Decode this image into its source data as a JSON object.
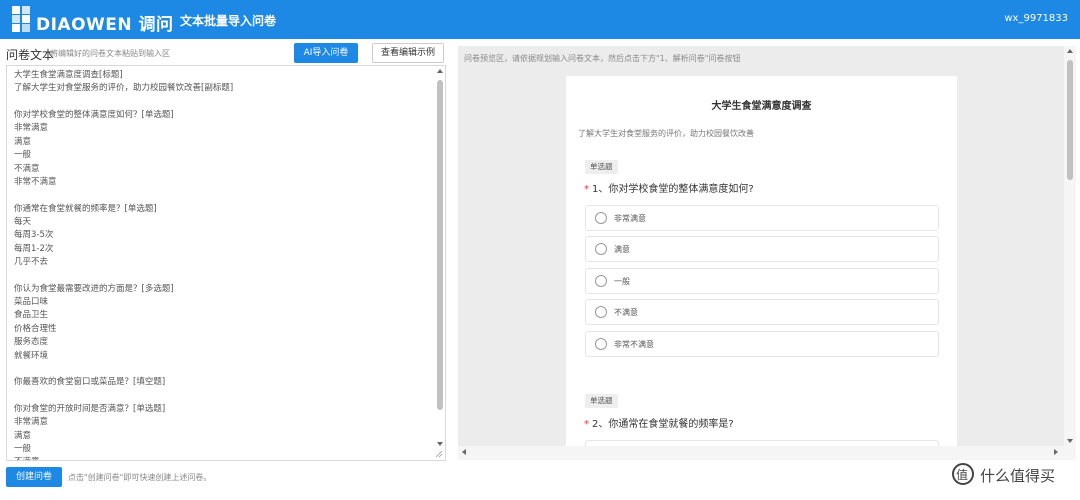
{
  "header": {
    "brand": "DIAOWEN 调问",
    "page_title": "文本批量导入问卷",
    "user": "wx_9971833"
  },
  "editor_panel": {
    "title": "问卷文本",
    "hint": "将编辑好的问卷文本粘贴到输入区",
    "ai_button": "AI导入问卷",
    "example_button": "查看编辑示例",
    "lines": [
      "大学生食堂满意度调查[标题]",
      "了解大学生对食堂服务的评价，助力校园餐饮改善[副标题]",
      "",
      "你对学校食堂的整体满意度如何？[单选题]",
      "非常满意",
      "满意",
      "一般",
      "不满意",
      "非常不满意",
      "",
      "你通常在食堂就餐的频率是？[单选题]",
      "每天",
      "每周3-5次",
      "每周1-2次",
      "几乎不去",
      "",
      "你认为食堂最需要改进的方面是？[多选题]",
      "菜品口味",
      "食品卫生",
      "价格合理性",
      "服务态度",
      "就餐环境",
      "",
      "你最喜欢的食堂窗口或菜品是？[填空题]",
      "",
      "你对食堂的开放时间是否满意？[单选题]",
      "非常满意",
      "满意",
      "一般",
      "不满意"
    ],
    "create_button": "创建问卷",
    "create_hint": "点击\"创建问卷\"即可快速创建上述问卷。"
  },
  "preview": {
    "hint": "问卷预览区，请依据规划输入问卷文本，然后点击下方\"1、解析问卷\"问卷按钮",
    "survey_title": "大学生食堂满意度调查",
    "survey_desc": "了解大学生对食堂服务的评价，助力校园餐饮改善",
    "questions": [
      {
        "type_label": "单选题",
        "required_mark": "*",
        "text": "1、你对学校食堂的整体满意度如何?",
        "options": [
          "非常满意",
          "满意",
          "一般",
          "不满意",
          "非常不满意"
        ]
      },
      {
        "type_label": "单选题",
        "required_mark": "*",
        "text": "2、你通常在食堂就餐的频率是?",
        "options": []
      }
    ]
  },
  "watermark": {
    "logo": "值",
    "text": "什么值得买"
  }
}
